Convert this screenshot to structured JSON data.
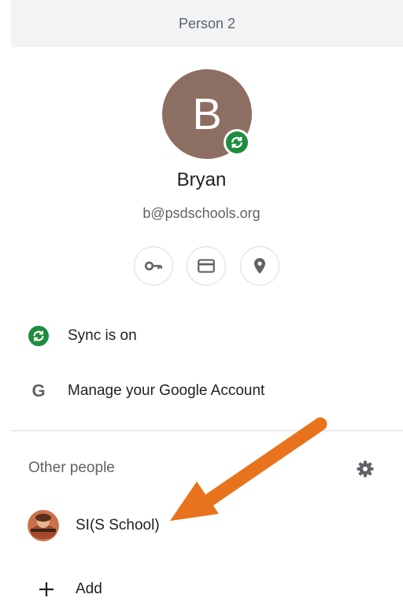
{
  "header": {
    "title": "Person 2"
  },
  "profile": {
    "initial": "B",
    "name": "Bryan",
    "email": "b@psdschools.org",
    "avatar_color": "#8d6e63"
  },
  "quick_actions": [
    {
      "name": "passwords",
      "icon": "key-icon"
    },
    {
      "name": "payment-methods",
      "icon": "credit-card-icon"
    },
    {
      "name": "addresses",
      "icon": "location-pin-icon"
    }
  ],
  "menu": {
    "sync_label": "Sync is on",
    "manage_label": "Manage your Google Account"
  },
  "other_people": {
    "title": "Other people",
    "people": [
      {
        "label": "SI(S School)"
      }
    ],
    "add_label": "Add"
  },
  "colors": {
    "sync_green": "#1e8e3e",
    "arrow_orange": "#e8731c",
    "header_bg": "#f1f3f4"
  }
}
